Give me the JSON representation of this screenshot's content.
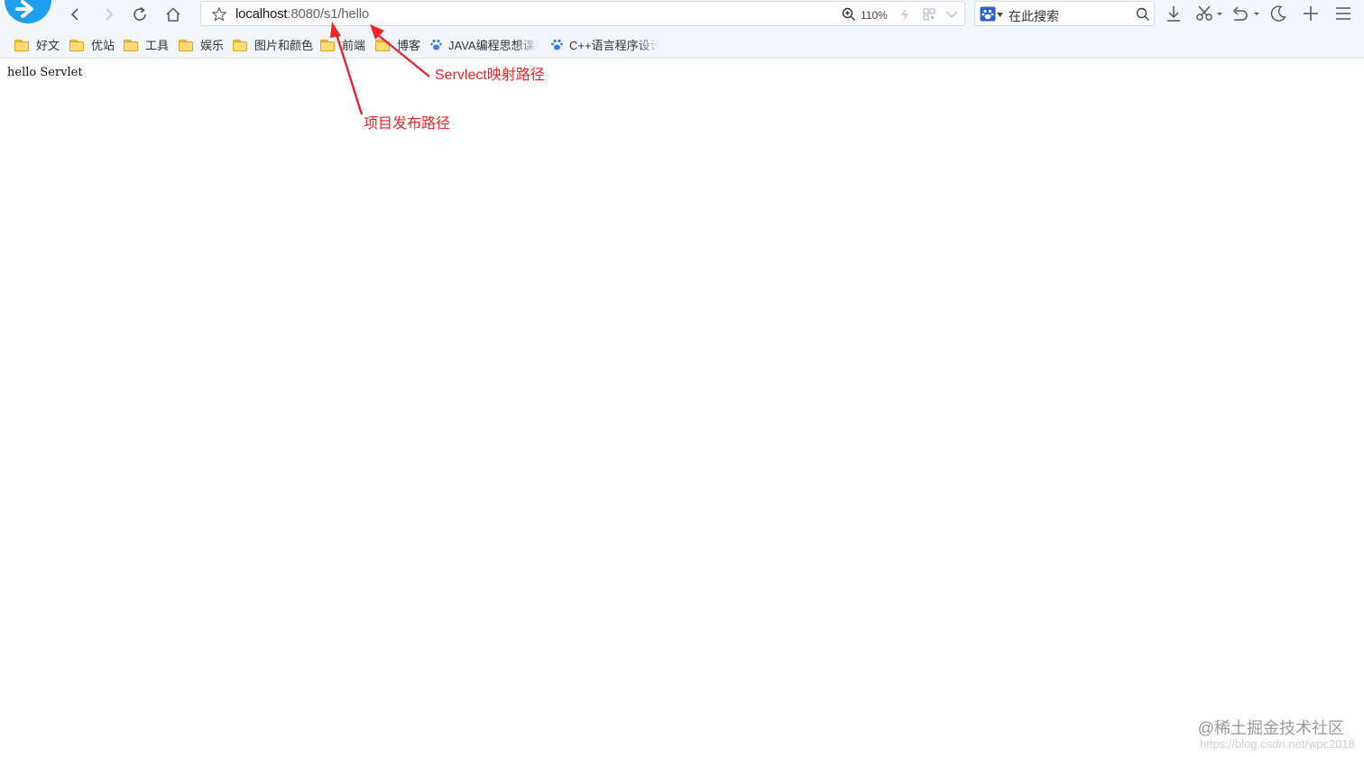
{
  "browser": {
    "url_host": "localhost",
    "url_rest": ":8080/s1/hello",
    "zoom": "110%",
    "search_placeholder": "在此搜索"
  },
  "bookmarks": [
    {
      "label": "好文",
      "icon": "folder-icon"
    },
    {
      "label": "优站",
      "icon": "folder-icon"
    },
    {
      "label": "工具",
      "icon": "folder-icon"
    },
    {
      "label": "娱乐",
      "icon": "folder-icon"
    },
    {
      "label": "图片和颜色",
      "icon": "folder-icon"
    },
    {
      "label": "前端",
      "icon": "folder-icon"
    },
    {
      "label": "博客",
      "icon": "folder-icon"
    },
    {
      "label": "JAVA编程思想课后",
      "icon": "baidu-paw-icon"
    },
    {
      "label": "C++语言程序设计",
      "icon": "baidu-paw-icon"
    }
  ],
  "page": {
    "body_text": "hello Servlet"
  },
  "annotations": {
    "servlet_path": "Servlect映射路径",
    "project_path": "项目发布路径",
    "color": "#e8262b"
  },
  "watermark": {
    "text": "@稀土掘金技术社区",
    "url": "https://blog.csdn.net/wpc2018"
  }
}
